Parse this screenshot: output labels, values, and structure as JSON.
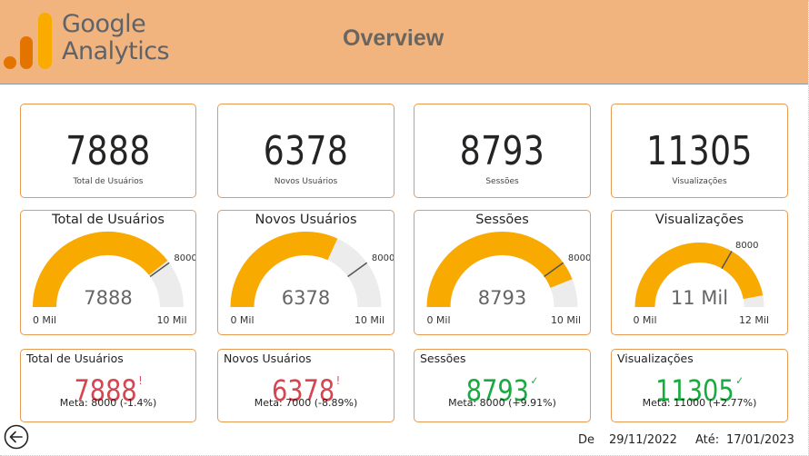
{
  "header": {
    "brand_line1": "Google",
    "brand_line2": "Analytics",
    "title": "Overview",
    "colors": {
      "banner": "#f1b47e",
      "logo_dark": "#e37400",
      "logo_light": "#f9ab00"
    }
  },
  "kpis": [
    {
      "value": "7888",
      "label": "Total de Usuários"
    },
    {
      "value": "6378",
      "label": "Novos Usuários"
    },
    {
      "value": "8793",
      "label": "Sessões"
    },
    {
      "value": "11305",
      "label": "Visualizações"
    }
  ],
  "gauges": [
    {
      "title": "Total de Usuários",
      "value": 7888,
      "value_label": "7888",
      "min": 0,
      "max": 10000,
      "target": 8000,
      "min_label": "0 Mil",
      "max_label": "10 Mil",
      "target_label": "8000"
    },
    {
      "title": "Novos Usuários",
      "value": 6378,
      "value_label": "6378",
      "min": 0,
      "max": 10000,
      "target": 8000,
      "min_label": "0 Mil",
      "max_label": "10 Mil",
      "target_label": "8000"
    },
    {
      "title": "Sessões",
      "value": 8793,
      "value_label": "8793",
      "min": 0,
      "max": 10000,
      "target": 8000,
      "min_label": "0 Mil",
      "max_label": "10 Mil",
      "target_label": "8000"
    },
    {
      "title": "Visualizações",
      "value": 11305,
      "value_label": "11 Mil",
      "min": 0,
      "max": 12000,
      "target": 8000,
      "min_label": "0 Mil",
      "max_label": "12 Mil",
      "target_label": "8000"
    }
  ],
  "gauge_colors": {
    "fill": "#f9aa00",
    "track": "#ececec",
    "target": "#555555"
  },
  "goals": [
    {
      "label": "Total de Usuários",
      "value": "7888",
      "mark": "!",
      "status": "red",
      "meta": "Meta: 8000 (-1.4%)"
    },
    {
      "label": "Novos Usuários",
      "value": "6378",
      "mark": "!",
      "status": "red",
      "meta": "Meta: 7000 (-8.89%)"
    },
    {
      "label": "Sessões",
      "value": "8793",
      "mark": "✓",
      "status": "green",
      "meta": "Meta: 8000 (+9.91%)"
    },
    {
      "label": "Visualizações",
      "value": "11305",
      "mark": "✓",
      "status": "green",
      "meta": "Meta: 11000 (+2.77%)"
    }
  ],
  "footer": {
    "back_icon": "arrow-left-circle-icon",
    "from_label": "De",
    "from_date": "29/11/2022",
    "to_label": "Até:",
    "to_date": "17/01/2023"
  }
}
